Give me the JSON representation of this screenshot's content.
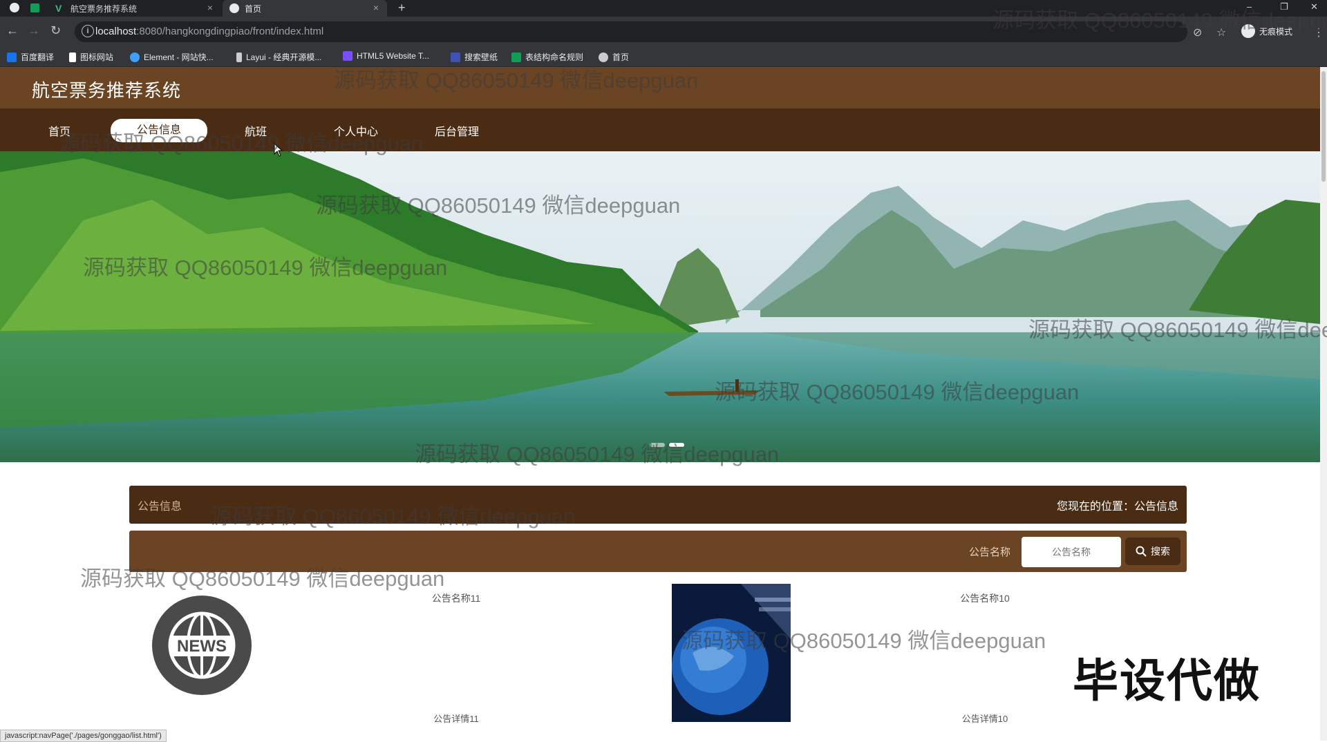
{
  "browser": {
    "tabs": [
      {
        "label": "航空票务推荐系统",
        "active": false
      },
      {
        "label": "首页",
        "active": true
      }
    ],
    "url_host": "localhost",
    "url_path": ":8080/hangkongdingpiao/front/index.html",
    "incognito_label": "无痕模式",
    "bookmarks": [
      {
        "label": "百度翻译",
        "color": "#1a73e8"
      },
      {
        "label": "图标网站",
        "color": "#ffffff"
      },
      {
        "label": "Element - 网站快...",
        "color": "#409eff"
      },
      {
        "label": "Layui - 经典开源模...",
        "color": "#cccccc"
      },
      {
        "label": "HTML5 Website T...",
        "color": "#7c4dff"
      },
      {
        "label": "搜索壁纸",
        "color": "#3f51b5"
      },
      {
        "label": "表结构命名规则",
        "color": "#0f9d58"
      },
      {
        "label": "首页",
        "color": "#cccccc"
      }
    ]
  },
  "site": {
    "title": "航空票务推荐系统",
    "nav": [
      "首页",
      "公告信息",
      "航班",
      "个人中心",
      "后台管理"
    ],
    "active_nav_index": 1
  },
  "crumb": {
    "left": "公告信息",
    "right": "您现在的位置：公告信息"
  },
  "search": {
    "label": "公告名称",
    "placeholder": "公告名称",
    "button": "搜索"
  },
  "cards": [
    {
      "name": "公告名称11",
      "detail": "公告详情11",
      "image": "news-globe-logo"
    },
    {
      "name": "公告名称10",
      "detail": "公告详情10",
      "image": "news-broadcast-globe"
    }
  ],
  "status_url": "javascript:navPage('./pages/gonggao/list.html')",
  "watermark": "源码获取 QQ86050149 微信deepguan",
  "stamp": "毕设代做",
  "colors": {
    "header": "#6b4423",
    "nav": "#4a2c14"
  }
}
